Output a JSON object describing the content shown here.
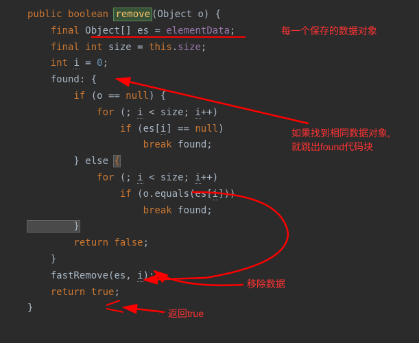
{
  "code": {
    "l1_public": "public ",
    "l1_boolean": "boolean ",
    "l1_remove": "remove",
    "l1_sig": "(Object o)",
    "l1_brace": " {",
    "l2_final": "    final ",
    "l2_type": "Object[] ",
    "l2_var": "es = ",
    "l2_field": "elementData",
    "l2_semi": ";",
    "l3_final": "    final int ",
    "l3_var": "size = ",
    "l3_this": "this",
    "l3_dot": ".",
    "l3_field": "size",
    "l3_semi": ";",
    "l4_int": "    int ",
    "l4_var": "i",
    "l4_assign": " = ",
    "l4_num": "0",
    "l4_semi": ";",
    "l5": "    found: {",
    "l6_if": "        if ",
    "l6_cond": "(o == ",
    "l6_null": "null",
    "l6_close": ") {",
    "l7_for": "            for ",
    "l7_a": "(; ",
    "l7_i1": "i",
    "l7_b": " < size; ",
    "l7_i2": "i",
    "l7_c": "++)",
    "l8_if": "                if ",
    "l8_a": "(es[",
    "l8_i": "i",
    "l8_b": "] == ",
    "l8_null": "null",
    "l8_c": ")",
    "l9_break": "                    break ",
    "l9_label": "found;",
    "l10_else": "        } else ",
    "l10_brace": "{",
    "l11_for": "            for ",
    "l11_a": "(; ",
    "l11_i1": "i",
    "l11_b": " < size; ",
    "l11_i2": "i",
    "l11_c": "++)",
    "l12_if": "                if ",
    "l12_a": "(o.equals(es[",
    "l12_i": "i",
    "l12_b": "]))",
    "l13_break": "                    break ",
    "l13_label": "found;",
    "l14": "        }",
    "l15_return": "        return false",
    "l15_semi": ";",
    "l16": "    }",
    "l17_fn": "    fastRemove",
    "l17_a": "(es, ",
    "l17_i": "i",
    "l17_b": ");",
    "l18_return": "    return true",
    "l18_semi": ";",
    "l19": "}"
  },
  "annotations": {
    "note1": "每一个保存的数据对象",
    "note2": "如果找到相同数据对象,\n就跳出found代码块",
    "note3": "移除数据",
    "note4": "返回true"
  }
}
